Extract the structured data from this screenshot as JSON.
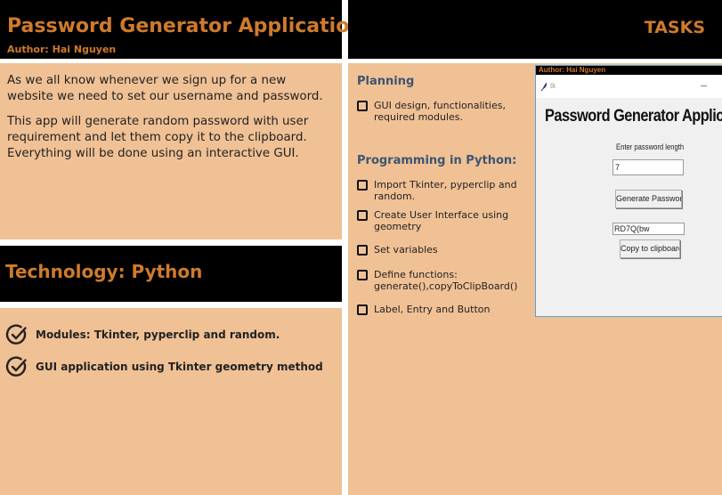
{
  "header": {
    "title": "Password Generator Application",
    "author": "Author: Hai Nguyen"
  },
  "intro": {
    "paragraph_1": "As we all know whenever we sign up for a new website we need to set our username and password.",
    "paragraph_2": "This app will generate random password with user requirement and let them copy it to the clipboard. Everything will be done using an interactive GUI."
  },
  "technology": {
    "title": "Technology: Python",
    "items": [
      {
        "label": "Modules: Tkinter, pyperclip and random.",
        "icon": "check-circle-icon"
      },
      {
        "label": "GUI application using Tkinter geometry method",
        "icon": "check-circle-icon"
      }
    ]
  },
  "tasks": {
    "title": "TASKS",
    "planning": {
      "title": "Planning",
      "items": [
        {
          "label": "GUI design, functionalities, required modules.",
          "checked": false
        }
      ]
    },
    "programming": {
      "title": "Programming in Python:",
      "items": [
        {
          "label": "Import Tkinter, pyperclip and random.",
          "checked": false
        },
        {
          "label": "Create User Interface using geometry",
          "checked": false
        },
        {
          "label": "Set variables",
          "checked": false
        },
        {
          "label": "Define functions: generate(),copyToClipBoard()",
          "checked": false
        },
        {
          "label": "Label, Entry and Button",
          "checked": false
        }
      ]
    }
  },
  "app_screenshot": {
    "author_bar": "Author: Hai Nguyen",
    "window_title": "tk",
    "heading": "Password Generator Application",
    "length_label": "Enter password length",
    "length_value": "7",
    "generate_button": "Generate Password",
    "password_value": "RD7Q(bw",
    "copy_button": "Copy to clipboard"
  },
  "colors": {
    "accent_orange": "#cf7a2c",
    "panel_tan": "#f0c195",
    "panel_dark": "#000000",
    "section_blue": "#3d5571",
    "screenshot_border": "#5aa0d8"
  }
}
